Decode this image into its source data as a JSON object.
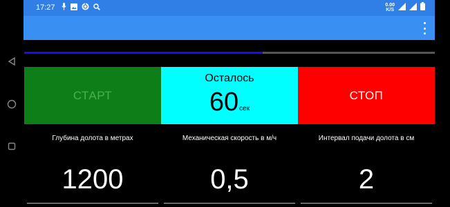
{
  "status_bar": {
    "time": "17:27",
    "net_speed_value": "0.00",
    "net_speed_unit": "K/S",
    "left_icons": [
      "mic-icon",
      "image-icon",
      "sync-icon",
      "search-icon"
    ],
    "right_icons": [
      "wifi-icon",
      "signal-icon",
      "battery-icon"
    ]
  },
  "app_bar": {
    "menu_icon": "more-vert-icon"
  },
  "progress": {
    "fraction": 0.58,
    "fill_color": "#1010FF",
    "track_color": "#555555"
  },
  "controls": {
    "start_label": "СТАРТ",
    "timer_label": "Осталось",
    "timer_value": "60",
    "timer_unit": "сек",
    "stop_label": "СТОП"
  },
  "fields": [
    {
      "label": "Глубина долота в метрах",
      "value": "1200"
    },
    {
      "label": "Механическая скорость в м/ч",
      "value": "0,5"
    },
    {
      "label": "Интервал подачи долота в см",
      "value": "2"
    }
  ],
  "colors": {
    "status_bar": "#2F7FE6",
    "app_bar": "#3A8FF3",
    "start": "#0E7F18",
    "start_text": "#4BB04F",
    "timer": "#00FFFF",
    "stop": "#FF0000"
  }
}
